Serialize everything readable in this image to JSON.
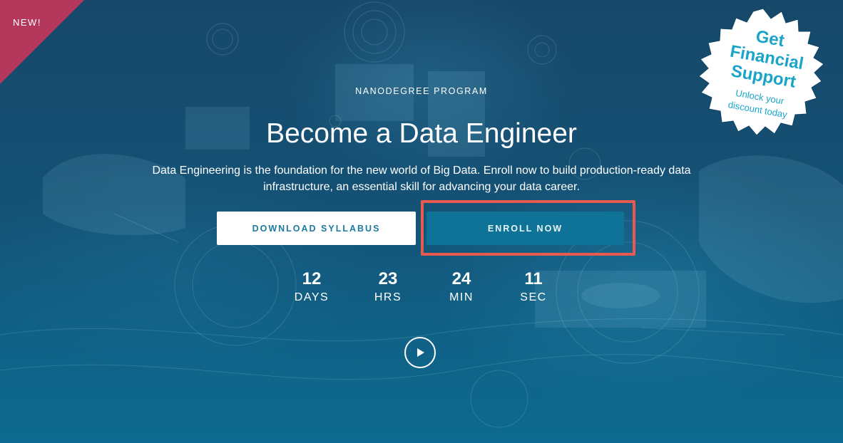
{
  "ribbon": {
    "label": "NEW!"
  },
  "badge": {
    "title_line1": "Get",
    "title_line2": "Financial",
    "title_line3": "Support",
    "sub_line1": "Unlock your",
    "sub_line2": "discount today"
  },
  "hero": {
    "eyebrow": "NANODEGREE PROGRAM",
    "title": "Become a Data Engineer",
    "description": "Data Engineering is the foundation for the new world of Big Data. Enroll now to build production-ready data infrastructure, an essential skill for advancing your data career."
  },
  "buttons": {
    "download": "DOWNLOAD SYLLABUS",
    "enroll": "ENROLL NOW"
  },
  "countdown": {
    "days": {
      "value": "12",
      "label": "DAYS"
    },
    "hours": {
      "value": "23",
      "label": "HRS"
    },
    "minutes": {
      "value": "24",
      "label": "MIN"
    },
    "seconds": {
      "value": "11",
      "label": "SEC"
    }
  },
  "icons": {
    "play": "play-icon"
  },
  "colors": {
    "accent": "#0e7396",
    "ribbon": "#b5385c",
    "badge_text": "#1aa5c8",
    "highlight": "#e85a4f"
  }
}
